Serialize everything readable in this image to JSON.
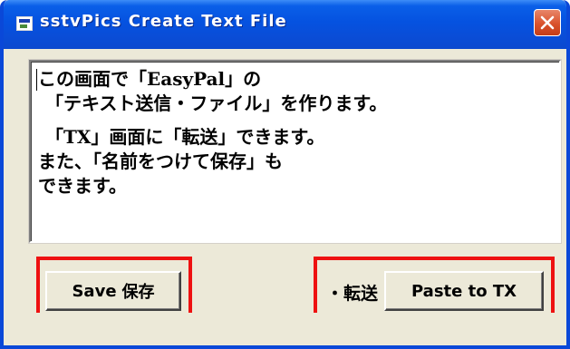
{
  "window": {
    "title": "sstvPics  Create Text File",
    "close_label": "×"
  },
  "textbox": {
    "lines": [
      "この画面で「EasyPal」の",
      "「テキスト送信・ファイル」を作ります。",
      "「TX」画面に「転送」できます。",
      "また、「名前をつけて保存」も",
      "できます。"
    ]
  },
  "buttons": {
    "save_en": "Save",
    "save_jp": "保存",
    "paste_prefix": "・転送",
    "paste_label": "Paste to TX"
  },
  "colors": {
    "titlebar": "#0552e0",
    "highlight": "#ee1111",
    "window_bg": "#ece9d8",
    "close_button": "#d9522c"
  }
}
